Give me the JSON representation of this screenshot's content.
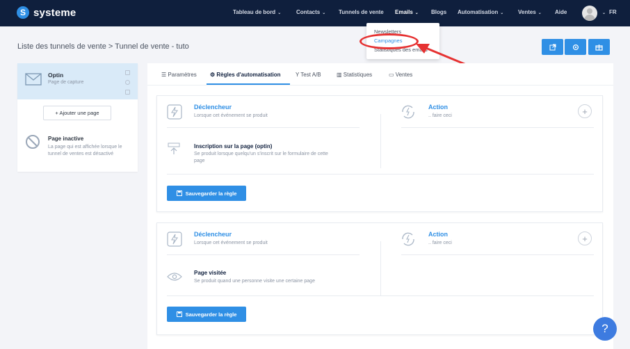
{
  "brand": {
    "name": "systeme",
    "logo_letter": "S"
  },
  "nav": {
    "items": [
      {
        "label": "Tableau de bord",
        "caret": "⌄"
      },
      {
        "label": "Contacts",
        "caret": "⌄"
      },
      {
        "label": "Tunnels de vente",
        "caret": ""
      },
      {
        "label": "Emails",
        "caret": "⌄"
      },
      {
        "label": "Blogs",
        "caret": ""
      },
      {
        "label": "Automatisation",
        "caret": "⌄"
      },
      {
        "label": "Ventes",
        "caret": "⌄"
      },
      {
        "label": "Aide",
        "caret": ""
      }
    ],
    "language": "FR",
    "language_caret": "⌄"
  },
  "emails_dropdown": {
    "items": [
      "Newsletters",
      "Campagnes",
      "Statistiques des emails"
    ],
    "highlighted": "Campagnes"
  },
  "breadcrumb": "Liste des tunnels de vente > Tunnel de vente - tuto",
  "sidebar": {
    "page": {
      "title": "Optin",
      "subtitle": "Page de capture"
    },
    "add_page_label": "+ Ajouter une page",
    "inactive": {
      "title": "Page inactive",
      "description": "La page qui est affichée lorsque le tunnel de ventes est désactivé"
    }
  },
  "tabs": [
    {
      "label": "Paramètres",
      "icon": "list-icon"
    },
    {
      "label": "Règles d'automatisation",
      "icon": "gears-icon"
    },
    {
      "label": "Test A/B",
      "icon": "split-icon"
    },
    {
      "label": "Statistiques",
      "icon": "bar-chart-icon"
    },
    {
      "label": "Ventes",
      "icon": "money-icon"
    }
  ],
  "rules": [
    {
      "trigger_title": "Déclencheur",
      "trigger_sub": "Lorsque cet événement se produit",
      "action_title": "Action",
      "action_sub": ".. faire ceci",
      "event_title": "Inscription sur la page (optin)",
      "event_desc": "Se produit lorsque quelqu'un s'inscrit sur le formulaire de cette page",
      "save_label": "Sauvegarder la règle"
    },
    {
      "trigger_title": "Déclencheur",
      "trigger_sub": "Lorsque cet événement se produit",
      "action_title": "Action",
      "action_sub": ".. faire ceci",
      "event_title": "Page visitée",
      "event_desc": "Se produit quand une personne visite une certaine page",
      "save_label": "Sauvegarder la règle"
    }
  ],
  "help_label": "?",
  "colors": {
    "nav_bg": "#0f1f3d",
    "accent": "#2f8fe5",
    "annotation_red": "#e63232",
    "selected_page_bg": "#d9eaf8"
  }
}
